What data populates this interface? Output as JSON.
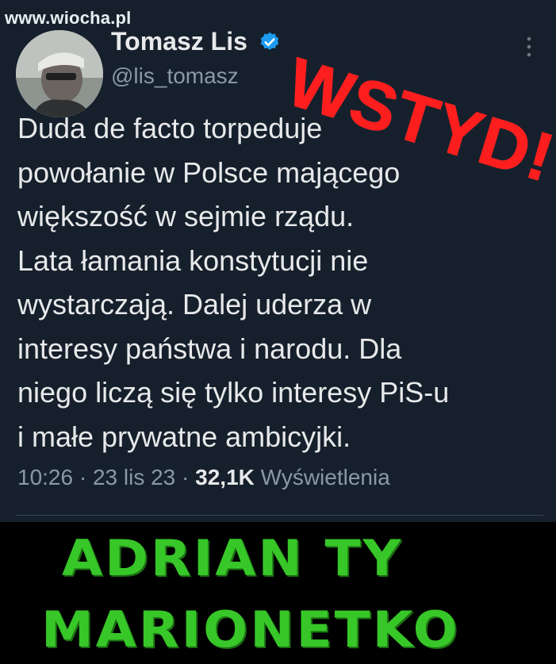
{
  "watermark": "www.wiocha.pl",
  "author": {
    "name": "Tomasz Lis",
    "handle": "@lis_tomasz"
  },
  "stamp": "WSTYD!",
  "tweet_lines": [
    "Duda de facto torpeduje",
    "powołanie w Polsce mającego",
    "większość w sejmie rządu.",
    "Lata łamania konstytucji nie",
    "wystarczają. Dalej uderza w",
    "interesy państwa i narodu. Dla",
    "niego liczą się tylko interesy PiS-u",
    "i małe prywatne ambicyjki."
  ],
  "meta": {
    "time": "10:26",
    "date": "23 lis 23",
    "views_count": "32,1K",
    "views_label": "Wyświetlenia"
  },
  "caption": {
    "line1": "ADRIAN TY",
    "line2": "MARIONETKO"
  },
  "colors": {
    "background": "#15202b",
    "verified": "#1d9bf0",
    "stamp": "#ff1e1e",
    "caption": "#37c728"
  }
}
